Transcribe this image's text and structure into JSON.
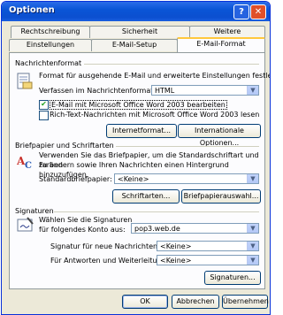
{
  "window": {
    "title": "Optionen",
    "help_label": "?",
    "close_label": "✕"
  },
  "tabs_row_back": [
    "Rechtschreibung",
    "Sicherheit",
    "Weitere"
  ],
  "tabs_row_front": [
    "Einstellungen",
    "E-Mail-Setup",
    "E-Mail-Format"
  ],
  "nachrichtenformat": {
    "title": "Nachrichtenformat",
    "description": "Format für ausgehende E-Mail und erweiterte Einstellungen festlegen.",
    "format_label": "Verfassen im Nachrichtenformat:",
    "format_value": "HTML",
    "checkbox1_label": "E-Mail mit Microsoft Office Word 2003 bearbeiten",
    "checkbox1_checked": "✔",
    "checkbox2_label": "Rich-Text-Nachrichten mit Microsoft Office Word 2003 lesen",
    "btn_internet": "Internetformat...",
    "btn_international": "Internationale Optionen..."
  },
  "briefpapier": {
    "title": "Briefpapier und Schriftarten",
    "description_1": "Verwenden Sie das Briefpapier, um die Standardschriftart und Farben",
    "description_2": "zu ändern sowie Ihren Nachrichten einen Hintergrund hinzuzufügen.",
    "std_label": "Standardbriefpapier:",
    "std_value": "<Keine>",
    "btn_fonts": "Schriftarten...",
    "btn_stationery": "Briefpapierauswahl..."
  },
  "signaturen": {
    "title": "Signaturen",
    "description_1": "Wählen Sie die Signaturen",
    "description_2": "für folgendes Konto aus:",
    "account_value": "pop3.web.de",
    "new_label": "Signatur für neue Nachrichten:",
    "new_value": "<Keine>",
    "reply_label": "Für Antworten und Weiterleitungen:",
    "reply_value": "<Keine>",
    "btn_signatures": "Signaturen..."
  },
  "footer": {
    "ok": "OK",
    "cancel": "Abbrechen",
    "apply": "Übernehmen"
  }
}
